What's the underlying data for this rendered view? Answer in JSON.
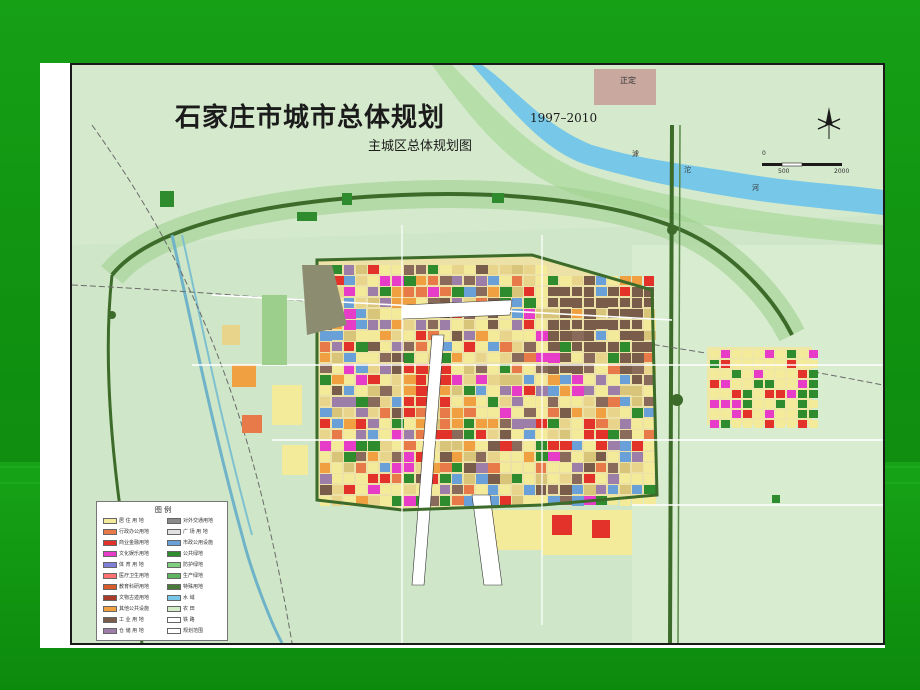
{
  "map": {
    "title": "石家庄市城市总体规划",
    "years": "1997–2010",
    "subtitle": "主城区总体规划图",
    "place_labels": [
      {
        "text": "正定",
        "pos": "north"
      },
      {
        "text": "滹",
        "pos": "river-1"
      },
      {
        "text": "沱",
        "pos": "river-2"
      },
      {
        "text": "河",
        "pos": "river-3"
      }
    ],
    "scale": {
      "marks": [
        "0",
        "500",
        "2000"
      ]
    },
    "legend": {
      "title": "图  例",
      "items": [
        {
          "label": "居 住 用 地",
          "color": "#f3ea9a"
        },
        {
          "label": "行政办公用地",
          "color": "#e87a4a"
        },
        {
          "label": "商业金融用地",
          "color": "#e2322a"
        },
        {
          "label": "文化娱乐用地",
          "color": "#e63cc8"
        },
        {
          "label": "体 育 用 地",
          "color": "#7f7fd8"
        },
        {
          "label": "医疗卫生用地",
          "color": "#ff7070"
        },
        {
          "label": "教育科研用地",
          "color": "#d85a2a"
        },
        {
          "label": "文物古迹用地",
          "color": "#a83a2a"
        },
        {
          "label": "其他公共设施",
          "color": "#f0a040"
        },
        {
          "label": "工 业 用 地",
          "color": "#7a5c4a"
        },
        {
          "label": "仓 储 用 地",
          "color": "#9d7ea8"
        },
        {
          "label": "对外交通用地",
          "color": "#8a8a8a"
        },
        {
          "label": "广 场 用 地",
          "color": "#e0e0e0"
        },
        {
          "label": "市政公用设施",
          "color": "#6aa0d8"
        },
        {
          "label": "公共绿地",
          "color": "#2e8b2e"
        },
        {
          "label": "防护绿地",
          "color": "#7fcf7f"
        },
        {
          "label": "生产绿地",
          "color": "#5fb55f"
        },
        {
          "label": "特殊用地",
          "color": "#4a7a3a"
        },
        {
          "label": "水 域",
          "color": "#76c7e8"
        },
        {
          "label": "农 田",
          "color": "#d5ecc8"
        },
        {
          "label": "铁 路",
          "color": "#ffffff"
        },
        {
          "label": "规划范围",
          "color": "#ffffff"
        }
      ]
    }
  },
  "colors": {
    "residential": "#f3ea9a",
    "commercial": "#e2322a",
    "industrial": "#7a5c4a",
    "green": "#2e8b2e",
    "water": "#76c7e8",
    "farmland": "#cfe7c8",
    "ring_road": "#3d6b2a"
  }
}
